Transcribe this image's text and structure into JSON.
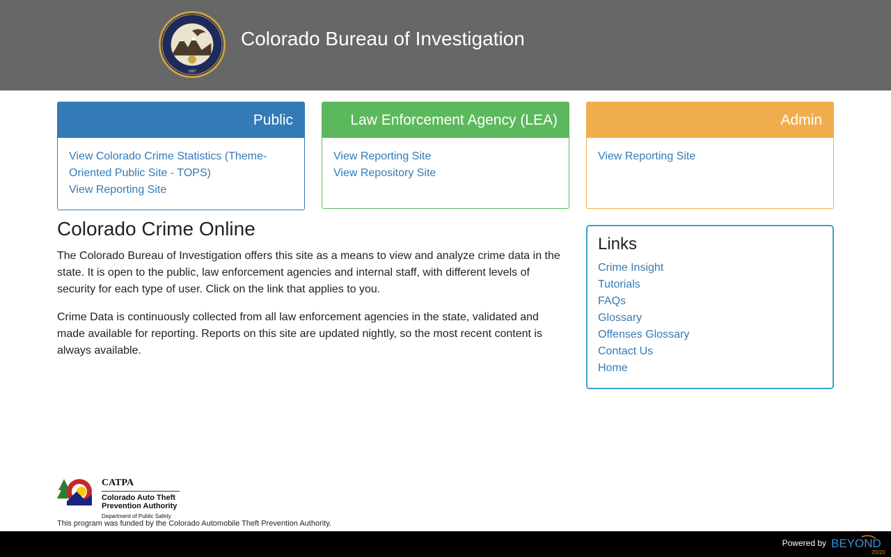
{
  "header": {
    "seal_text": "COLORADO BUREAU OF INVESTIGATION",
    "seal_year": "1967",
    "title": "Colorado Bureau of Investigation"
  },
  "cards": {
    "public": {
      "title": "Public",
      "links": [
        "View Colorado Crime Statistics (Theme-Oriented Public Site - TOPS)",
        "View Reporting Site"
      ],
      "color": "#337ab7"
    },
    "lea": {
      "title": "Law Enforcement Agency (LEA)",
      "links": [
        "View Reporting Site",
        "View Repository Site"
      ],
      "color": "#5cb85c"
    },
    "admin": {
      "title": "Admin",
      "links": [
        "View Reporting Site"
      ],
      "color": "#f0ad4e"
    }
  },
  "intro": {
    "heading": "Colorado Crime Online",
    "paragraphs": [
      "The Colorado Bureau of Investigation offers this site as a means to view and analyze crime data in the state. It is open to the public, law enforcement agencies and internal staff, with different levels of security for each type of user. Click on the link that applies to you.",
      "Crime Data is continuously collected from all law enforcement agencies in the state, validated and made available for reporting. Reports on this site are updated nightly, so the most recent content is always available."
    ]
  },
  "links_panel": {
    "heading": "Links",
    "items": [
      "Crime Insight",
      "Tutorials",
      "FAQs",
      "Glossary",
      "Offenses Glossary",
      "Contact Us",
      "Home"
    ]
  },
  "catpa": {
    "acronym": "CATPA",
    "full_line1": "Colorado Auto Theft",
    "full_line2": "Prevention Authority",
    "dept": "Department of Public Safety",
    "funding": "This program was funded by the Colorado Automobile Theft Prevention Authority."
  },
  "footer": {
    "powered_by": "Powered by",
    "brand": "BEYOND",
    "brand_suffix": "20/20"
  },
  "colors": {
    "header_bg": "#666767",
    "link": "#337ab7",
    "links_border": "#3aa0cc",
    "footer_bg": "#000000"
  }
}
